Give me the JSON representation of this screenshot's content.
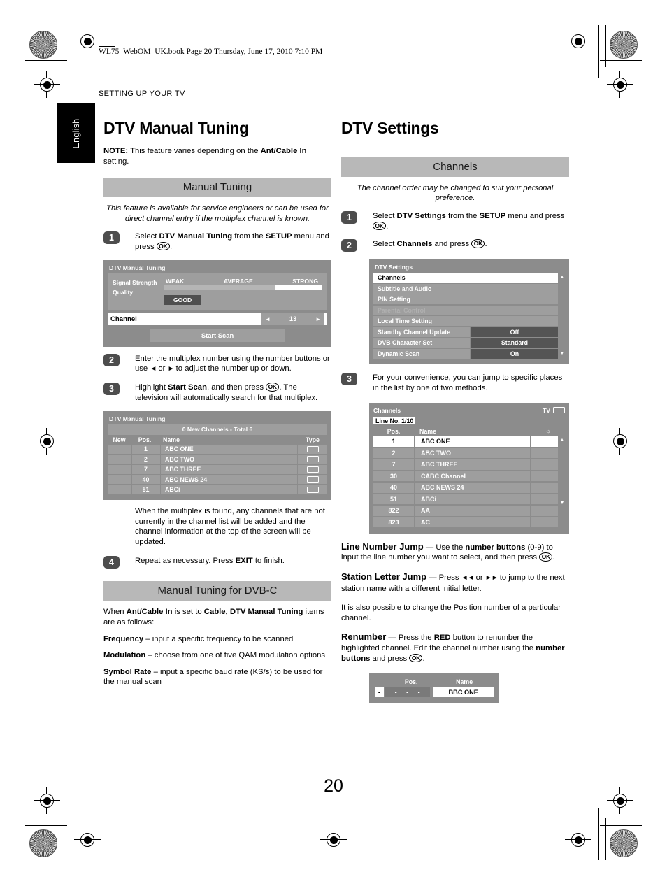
{
  "print": {
    "file_header": "WL75_WebOM_UK.book  Page 20  Thursday, June 17, 2010  7:10 PM",
    "page_number": "20",
    "language_tab": "English",
    "running_head": "SETTING UP YOUR TV"
  },
  "left": {
    "title": "DTV Manual Tuning",
    "note_prefix": "NOTE:",
    "note_text": " This feature varies depending on the ",
    "note_bold": "Ant/Cable In",
    "note_suffix": " setting.",
    "band_manual_tuning": "Manual Tuning",
    "intro": "This feature is available for service engineers or can be used for direct channel entry if the multiplex channel is known.",
    "steps": [
      {
        "num": "1",
        "html": "Select <b>DTV Manual Tuning</b> from the <b>SETUP</b> menu and press <span class=\"ok\">OK</span>."
      },
      {
        "num": "2",
        "html": "Enter the multiplex number using the number buttons or use <span class=\"arr\">&#9668;</span> or <span class=\"arr\">&#9658;</span> to adjust the number up or down."
      },
      {
        "num": "3",
        "html": "Highlight <b>Start Scan</b>, and then press <span class=\"ok\">OK</span>. The television will automatically search for that multiplex."
      },
      {
        "num": "4",
        "html": "Repeat as necessary. Press <b>EXIT</b> to finish."
      }
    ],
    "after_scan_text": "When the multiplex is found, any channels that are not currently in the channel list will be added and the channel information at the top of the screen will be updated.",
    "band_dvbc": "Manual Tuning for DVB-C",
    "dvbc_intro_html": "When <b>Ant/Cable In</b> is set to <b>Cable, DTV Manual Tuning</b> items are as follows:",
    "dvbc_items": [
      {
        "term": "Frequency",
        "desc": " – input a specific frequency to be scanned"
      },
      {
        "term": "Modulation",
        "desc": " – choose from one of five QAM modulation options"
      },
      {
        "term": "Symbol Rate",
        "desc": " – input a specific baud rate (KS/s) to be used for the manual scan"
      }
    ]
  },
  "right": {
    "title": "DTV Settings",
    "band_channels": "Channels",
    "intro": "The channel order may be changed to suit your personal preference.",
    "steps": [
      {
        "num": "1",
        "html": "Select <b>DTV Settings</b> from the <b>SETUP</b> menu and press <span class=\"ok\">OK</span>."
      },
      {
        "num": "2",
        "html": "Select <b>Channels</b> and press <span class=\"ok\">OK</span>."
      },
      {
        "num": "3",
        "html": "For your convenience, you can jump to specific places in the list by one of two methods."
      }
    ],
    "jump_paragraphs": [
      {
        "term": "Line Number Jump",
        "html": " — Use the <b>number buttons</b> (0-9) to input the line number you want to select, and then press <span class=\"ok\">OK</span>."
      },
      {
        "term": "Station Letter Jump",
        "html": " — Press <span class=\"arr\">&#9668;&#9668;</span> or <span class=\"arr\">&#9658;&#9658;</span> to jump to the next station name with a different initial letter."
      }
    ],
    "position_note": "It is also possible to change the Position number of a particular channel.",
    "renumber_para": {
      "term": "Renumber",
      "html": " — Press the <b>RED</b> button to renumber the highlighted channel. Edit the channel number using the <b>number buttons</b> and press <span class=\"ok\">OK</span>."
    }
  },
  "screens": {
    "manual_tuning": {
      "title": "DTV Manual Tuning",
      "signal_label": "Signal Strength",
      "quality_label": "Quality",
      "scale": [
        "WEAK",
        "AVERAGE",
        "STRONG"
      ],
      "quality_value": "GOOD",
      "channel_label": "Channel",
      "channel_value": "13",
      "left_arrow": "◄",
      "right_arrow": "►",
      "start_scan": "Start Scan"
    },
    "found_channels": {
      "title": "DTV Manual Tuning",
      "summary": "0 New Channels - Total 6",
      "columns": [
        "New",
        "Pos.",
        "Name",
        "Type"
      ],
      "rows": [
        {
          "new": "",
          "pos": "1",
          "name": "ABC ONE",
          "type": "tv-icon"
        },
        {
          "new": "",
          "pos": "2",
          "name": "ABC TWO",
          "type": "tv-icon"
        },
        {
          "new": "",
          "pos": "7",
          "name": "ABC THREE",
          "type": "tv-icon"
        },
        {
          "new": "",
          "pos": "40",
          "name": "ABC NEWS 24",
          "type": "tv-icon"
        },
        {
          "new": "",
          "pos": "51",
          "name": "ABCi",
          "type": "tv-icon"
        }
      ]
    },
    "dtv_settings": {
      "title": "DTV Settings",
      "rows": [
        {
          "label": "Channels",
          "value": "",
          "state": "selected"
        },
        {
          "label": "Subtitle and Audio",
          "value": "",
          "state": "normal"
        },
        {
          "label": "PIN Setting",
          "value": "",
          "state": "normal"
        },
        {
          "label": "Parental Control",
          "value": "",
          "state": "disabled"
        },
        {
          "label": "Local Time Setting",
          "value": "",
          "state": "normal"
        },
        {
          "label": "Standby Channel Update",
          "value": "Off",
          "state": "normal"
        },
        {
          "label": "DVB Character Set",
          "value": "Standard",
          "state": "normal"
        },
        {
          "label": "Dynamic Scan",
          "value": "On",
          "state": "normal"
        }
      ],
      "scroll_up": "▲",
      "scroll_down": "▼"
    },
    "channels_list": {
      "title": "Channels",
      "line_no": "Line No. 1/10",
      "source": "TV",
      "columns": [
        "Pos.",
        "Name"
      ],
      "rows": [
        {
          "pos": "1",
          "name": "ABC ONE",
          "state": "selected"
        },
        {
          "pos": "2",
          "name": "ABC TWO",
          "state": "normal"
        },
        {
          "pos": "7",
          "name": "ABC THREE",
          "state": "normal"
        },
        {
          "pos": "30",
          "name": "CABC Channel",
          "state": "normal"
        },
        {
          "pos": "40",
          "name": "ABC NEWS 24",
          "state": "normal"
        },
        {
          "pos": "51",
          "name": "ABCi",
          "state": "normal"
        },
        {
          "pos": "822",
          "name": "AA",
          "state": "normal"
        },
        {
          "pos": "823",
          "name": "AC",
          "state": "normal"
        }
      ],
      "scroll_up": "▲",
      "scroll_down": "▼"
    },
    "renumber": {
      "columns": [
        "Pos.",
        "Name"
      ],
      "first_digit": "-",
      "digits": [
        "-",
        "-",
        "-"
      ],
      "name": "BBC ONE"
    }
  }
}
